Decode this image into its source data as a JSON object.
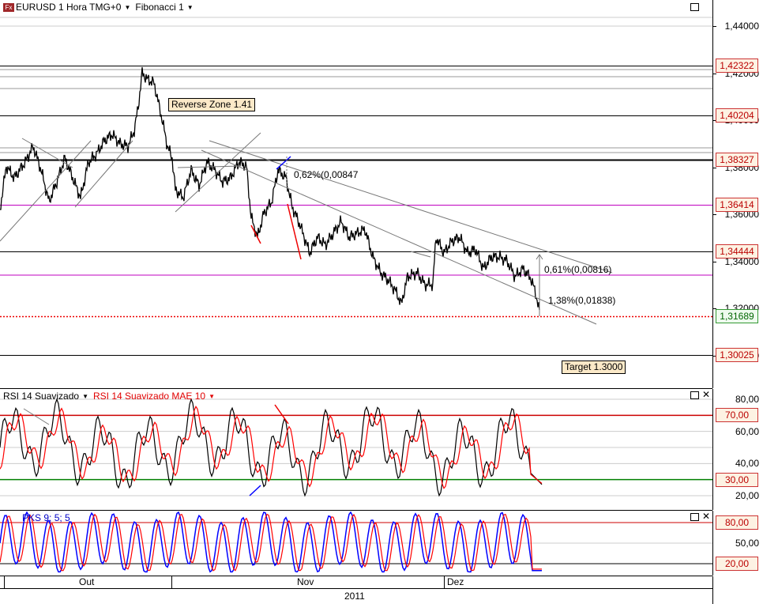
{
  "header": {
    "symbol_icon": "fx-icon",
    "symbol_icon_text": "Fx",
    "title": "EURUSD 1 Hora TMG+0",
    "study": "Fibonacci 1"
  },
  "price_axis": {
    "ticks": [
      "1,44000",
      "1,42000",
      "1,40000",
      "1,38000",
      "1,36000",
      "1,34000",
      "1,32000",
      "1,30000"
    ],
    "levels": [
      {
        "label": "1,42322",
        "price": 1.42322,
        "kind": "black"
      },
      {
        "label": "1,40204",
        "price": 1.40204,
        "kind": "black"
      },
      {
        "label": "1,38327",
        "price": 1.38327,
        "kind": "black"
      },
      {
        "label": "1,36414",
        "price": 1.36414,
        "kind": "purple"
      },
      {
        "label": "1,34444",
        "price": 1.34444,
        "kind": "black"
      },
      {
        "label": "1,31689",
        "price": 1.31689,
        "kind": "current"
      },
      {
        "label": "1,30025",
        "price": 1.30025,
        "kind": "black"
      }
    ]
  },
  "annotations": {
    "reverse_zone": "Reverse Zone 1.41",
    "target": "Target 1.3000",
    "fib1": "0,62%(0,00847",
    "fib2": "0,61%(0,00816)",
    "fib3": "1,38%(0,01838)"
  },
  "rsi_pane": {
    "label1": "RSI 14 Suavizado",
    "label2": "RSI 14 Suavizado MAE 10",
    "ticks": [
      "80,00",
      "60,00",
      "40,00",
      "20,00"
    ],
    "level_high": "70,00",
    "level_low": "30,00"
  },
  "pks_pane": {
    "label": "PKS 9; 5; 5",
    "ticks": [
      "50,00"
    ],
    "level_high": "80,00",
    "level_low": "20,00"
  },
  "date_axis": {
    "months": [
      "Out",
      "Nov",
      "Dez"
    ],
    "year": "2011"
  },
  "colors": {
    "level_high": "#cc0000",
    "level_low": "#008000",
    "purple": "#c000c0",
    "rsi_ma": "#ff0000",
    "pks_main": "#0000ff",
    "pks_signal": "#ff0000"
  }
}
